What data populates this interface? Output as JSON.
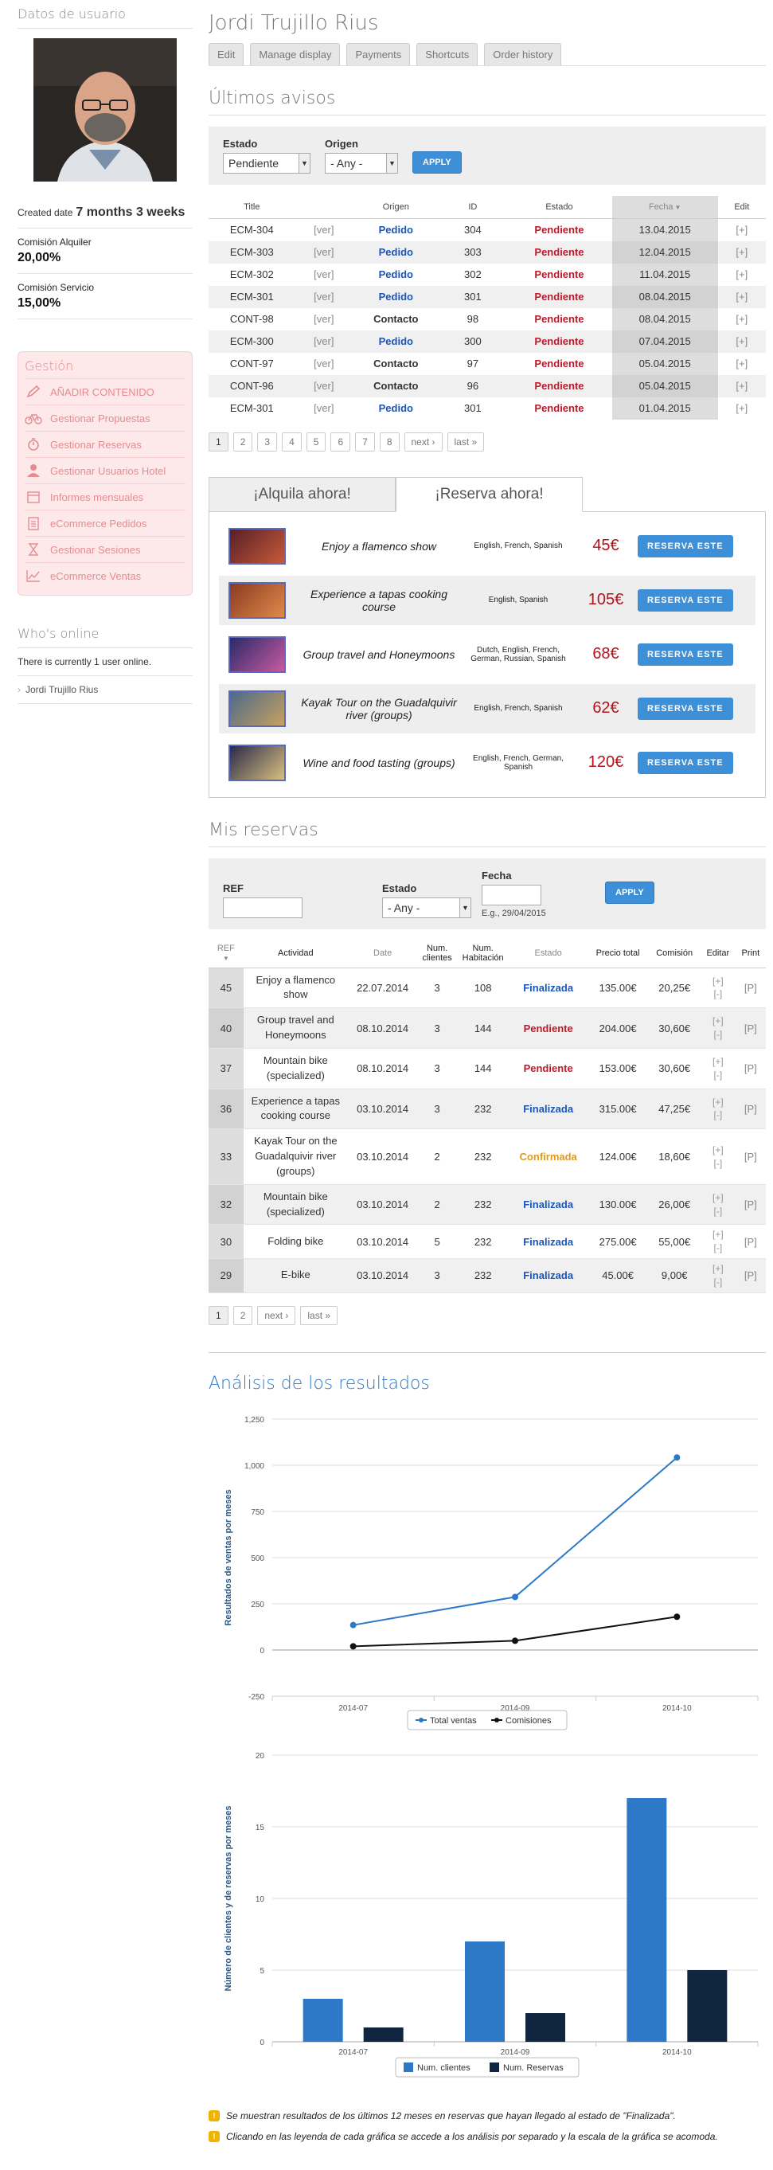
{
  "sidebar": {
    "user_data_title": "Datos de usuario",
    "created_label": "Created date",
    "created_value": "7 months 3 weeks",
    "comision_alquiler_label": "Comisión Alquiler",
    "comision_alquiler_value": "20,00%",
    "comision_servicio_label": "Comisión Servicio",
    "comision_servicio_value": "15,00%",
    "gestion_title": "Gestión",
    "gestion_items": [
      {
        "label": "AÑADIR CONTENIDO",
        "icon": "pencil-icon"
      },
      {
        "label": "Gestionar Propuestas",
        "icon": "bicycle-icon"
      },
      {
        "label": "Gestionar Reservas",
        "icon": "stopwatch-icon"
      },
      {
        "label": "Gestionar Usuarios Hotel",
        "icon": "user-icon"
      },
      {
        "label": "Informes mensuales",
        "icon": "calendar-icon"
      },
      {
        "label": "eCommerce Pedidos",
        "icon": "clipboard-icon"
      },
      {
        "label": "Gestionar Sesiones",
        "icon": "hourglass-icon"
      },
      {
        "label": "eCommerce Ventas",
        "icon": "chart-icon"
      }
    ],
    "online_title": "Who's online",
    "online_text": "There is currently 1 user online.",
    "online_user": "Jordi Trujillo Rius"
  },
  "header": {
    "user_name": "Jordi Trujillo Rius",
    "tabs": [
      "Edit",
      "Manage display",
      "Payments",
      "Shortcuts",
      "Order history"
    ]
  },
  "avisos": {
    "title": "Últimos avisos",
    "estado_label": "Estado",
    "estado_value": "Pendiente",
    "origen_label": "Origen",
    "origen_value": "- Any -",
    "apply": "APPLY",
    "columns": [
      "Title",
      "",
      "Origen",
      "ID",
      "Estado",
      "Fecha",
      "Edit"
    ],
    "rows": [
      [
        "ECM-304",
        "[ver]",
        "Pedido",
        "304",
        "Pendiente",
        "13.04.2015",
        "[+]"
      ],
      [
        "ECM-303",
        "[ver]",
        "Pedido",
        "303",
        "Pendiente",
        "12.04.2015",
        "[+]"
      ],
      [
        "ECM-302",
        "[ver]",
        "Pedido",
        "302",
        "Pendiente",
        "11.04.2015",
        "[+]"
      ],
      [
        "ECM-301",
        "[ver]",
        "Pedido",
        "301",
        "Pendiente",
        "08.04.2015",
        "[+]"
      ],
      [
        "CONT-98",
        "[ver]",
        "Contacto",
        "98",
        "Pendiente",
        "08.04.2015",
        "[+]"
      ],
      [
        "ECM-300",
        "[ver]",
        "Pedido",
        "300",
        "Pendiente",
        "07.04.2015",
        "[+]"
      ],
      [
        "CONT-97",
        "[ver]",
        "Contacto",
        "97",
        "Pendiente",
        "05.04.2015",
        "[+]"
      ],
      [
        "CONT-96",
        "[ver]",
        "Contacto",
        "96",
        "Pendiente",
        "05.04.2015",
        "[+]"
      ],
      [
        "ECM-301",
        "[ver]",
        "Pedido",
        "301",
        "Pendiente",
        "01.04.2015",
        "[+]"
      ]
    ],
    "pager": [
      "1",
      "2",
      "3",
      "4",
      "5",
      "6",
      "7",
      "8",
      "next ›",
      "last »"
    ]
  },
  "promo": {
    "tab_alquila": "¡Alquila ahora!",
    "tab_reserva": "¡Reserva ahora!",
    "button": "RESERVA ESTE",
    "items": [
      {
        "name": "Enjoy a flamenco show",
        "langs": "English, French, Spanish",
        "price": "45€"
      },
      {
        "name": "Experience a tapas cooking course",
        "langs": "English, Spanish",
        "price": "105€"
      },
      {
        "name": "Group travel and Honeymoons",
        "langs": "Dutch, English, French, German, Russian, Spanish",
        "price": "68€"
      },
      {
        "name": "Kayak Tour on the Guadalquivir river (groups)",
        "langs": "English, French, Spanish",
        "price": "62€"
      },
      {
        "name": "Wine and food tasting (groups)",
        "langs": "English, French, German, Spanish",
        "price": "120€"
      }
    ]
  },
  "reservas": {
    "title": "Mis reservas",
    "ref_label": "REF",
    "estado_label": "Estado",
    "estado_value": "- Any -",
    "fecha_label": "Fecha",
    "fecha_hint": "E.g., 29/04/2015",
    "apply": "APPLY",
    "columns": [
      "REF",
      "Actividad",
      "Date",
      "Num. clientes",
      "Num. Habitación",
      "Estado",
      "Precio total",
      "Comisión",
      "Editar",
      "Print"
    ],
    "rows": [
      [
        "45",
        "Enjoy a flamenco show",
        "22.07.2014",
        "3",
        "108",
        "Finalizada",
        "135.00€",
        "20,25€",
        "[+] [-]",
        "[P]"
      ],
      [
        "40",
        "Group travel and Honeymoons",
        "08.10.2014",
        "3",
        "144",
        "Pendiente",
        "204.00€",
        "30,60€",
        "[+] [-]",
        "[P]"
      ],
      [
        "37",
        "Mountain bike (specialized)",
        "08.10.2014",
        "3",
        "144",
        "Pendiente",
        "153.00€",
        "30,60€",
        "[+] [-]",
        "[P]"
      ],
      [
        "36",
        "Experience a tapas cooking course",
        "03.10.2014",
        "3",
        "232",
        "Finalizada",
        "315.00€",
        "47,25€",
        "[+] [-]",
        "[P]"
      ],
      [
        "33",
        "Kayak Tour on the Guadalquivir river (groups)",
        "03.10.2014",
        "2",
        "232",
        "Confirmada",
        "124.00€",
        "18,60€",
        "[+] [-]",
        "[P]"
      ],
      [
        "32",
        "Mountain bike (specialized)",
        "03.10.2014",
        "2",
        "232",
        "Finalizada",
        "130.00€",
        "26,00€",
        "[+] [-]",
        "[P]"
      ],
      [
        "30",
        "Folding bike",
        "03.10.2014",
        "5",
        "232",
        "Finalizada",
        "275.00€",
        "55,00€",
        "[+] [-]",
        "[P]"
      ],
      [
        "29",
        "E-bike",
        "03.10.2014",
        "3",
        "232",
        "Finalizada",
        "45.00€",
        "9,00€",
        "[+] [-]",
        "[P]"
      ]
    ],
    "pager": [
      "1",
      "2",
      "next ›",
      "last »"
    ]
  },
  "analysis_title": "Análisis de los resultados",
  "chart_data": [
    {
      "type": "line",
      "x": [
        "2014-07",
        "2014-09",
        "2014-10"
      ],
      "series": [
        {
          "name": "Total ventas",
          "values": [
            135,
            287,
            1042
          ],
          "color": "#2d79c7"
        },
        {
          "name": "Comisiones",
          "values": [
            20,
            50,
            180
          ],
          "color": "#111111"
        }
      ],
      "ylabel": "Resultados de ventas por meses",
      "ylim": [
        -250,
        1250
      ],
      "yticks": [
        "-250",
        "0",
        "250",
        "500",
        "750",
        "1,000",
        "1,250"
      ],
      "legend": "bottom",
      "grid": true
    },
    {
      "type": "bar",
      "categories": [
        "2014-07",
        "2014-09",
        "2014-10"
      ],
      "series": [
        {
          "name": "Num. clientes",
          "values": [
            3,
            7,
            17
          ],
          "color": "#2d79c7"
        },
        {
          "name": "Num. Reservas",
          "values": [
            1,
            2,
            5
          ],
          "color": "#0f2540"
        }
      ],
      "ylabel": "Número de clientes y de reservas por meses",
      "ylim": [
        0,
        20
      ],
      "yticks": [
        "0",
        "5",
        "10",
        "15",
        "20"
      ],
      "legend": "bottom",
      "grid": true
    }
  ],
  "notes": [
    "Se muestran resultados de los últimos 12 meses en reservas que hayan llegado al estado de \"Finalizada\".",
    "Clicando en las leyenda de cada gráfica se accede a los análisis por separado y la escala de la gráfica se acomoda."
  ]
}
